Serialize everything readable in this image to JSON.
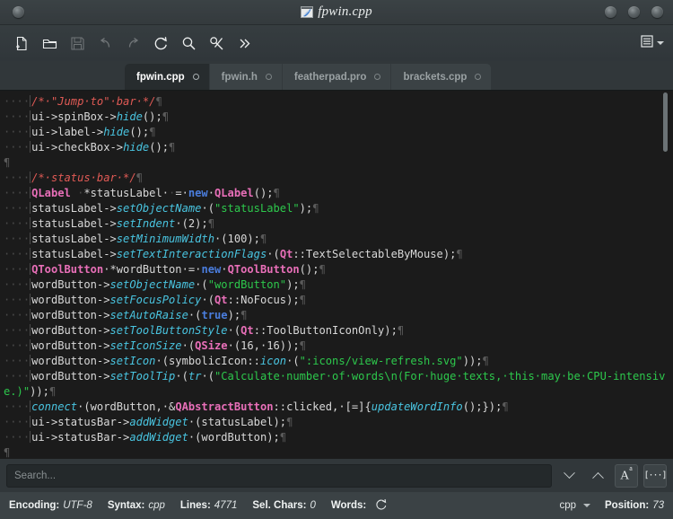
{
  "window": {
    "title": "fpwin.cpp",
    "icon": "featherpad-icon",
    "left_buttons": [
      "menu-button"
    ],
    "right_buttons": [
      "minimize-button",
      "maximize-button",
      "close-button"
    ]
  },
  "toolbar": {
    "items": [
      {
        "name": "new-file-button",
        "icon": "new-file-icon",
        "enabled": true
      },
      {
        "name": "open-file-button",
        "icon": "open-folder-icon",
        "enabled": true
      },
      {
        "name": "save-button",
        "icon": "save-disk-icon",
        "enabled": false
      },
      {
        "name": "undo-button",
        "icon": "undo-arrow-icon",
        "enabled": false
      },
      {
        "name": "redo-button",
        "icon": "redo-arrow-icon",
        "enabled": false
      },
      {
        "name": "reload-button",
        "icon": "reload-icon",
        "enabled": true
      },
      {
        "name": "find-button",
        "icon": "search-icon",
        "enabled": true
      },
      {
        "name": "replace-button",
        "icon": "cut-scissors-icon",
        "enabled": true
      },
      {
        "name": "overflow-button",
        "icon": "double-chevron-right-icon",
        "enabled": true
      }
    ],
    "menu_icon": "hamburger-menu-icon",
    "menu_caret": "chevron-down-icon"
  },
  "tabs": [
    {
      "label": "fpwin.cpp",
      "active": true
    },
    {
      "label": "fpwin.h",
      "active": false
    },
    {
      "label": "featherpad.pro",
      "active": false
    },
    {
      "label": "brackets.cpp",
      "active": false
    }
  ],
  "editor": {
    "lines": [
      [
        {
          "t": "    ",
          "c": "ws-dots"
        },
        {
          "t": "|",
          "c": "guide"
        },
        {
          "t": "/* \"Jump to\" bar */",
          "c": "cmt"
        },
        {
          "t": "¶",
          "c": "pilcrow"
        }
      ],
      [
        {
          "t": "    ",
          "c": "ws-dots"
        },
        {
          "t": "|",
          "c": "guide"
        },
        {
          "t": "ui->spinBox->",
          "c": "plain"
        },
        {
          "t": "hide",
          "c": "fn"
        },
        {
          "t": "();",
          "c": "plain"
        },
        {
          "t": "¶",
          "c": "pilcrow"
        }
      ],
      [
        {
          "t": "    ",
          "c": "ws-dots"
        },
        {
          "t": "|",
          "c": "guide"
        },
        {
          "t": "ui->label->",
          "c": "plain"
        },
        {
          "t": "hide",
          "c": "fn"
        },
        {
          "t": "();",
          "c": "plain"
        },
        {
          "t": "¶",
          "c": "pilcrow"
        }
      ],
      [
        {
          "t": "    ",
          "c": "ws-dots"
        },
        {
          "t": "|",
          "c": "guide"
        },
        {
          "t": "ui->checkBox->",
          "c": "plain"
        },
        {
          "t": "hide",
          "c": "fn"
        },
        {
          "t": "();",
          "c": "plain"
        },
        {
          "t": "¶",
          "c": "pilcrow"
        }
      ],
      [
        {
          "t": "¶",
          "c": "pilcrow"
        }
      ],
      [
        {
          "t": "    ",
          "c": "ws-dots"
        },
        {
          "t": "|",
          "c": "guide"
        },
        {
          "t": "/* status bar */",
          "c": "cmt"
        },
        {
          "t": "¶",
          "c": "pilcrow"
        }
      ],
      [
        {
          "t": "    ",
          "c": "ws-dots"
        },
        {
          "t": "|",
          "c": "guide"
        },
        {
          "t": "QLabel",
          "c": "type"
        },
        {
          "t": " ·",
          "c": "dot"
        },
        {
          "t": "*statusLabel ",
          "c": "plain"
        },
        {
          "t": "·",
          "c": "dot"
        },
        {
          "t": "= ",
          "c": "plain"
        },
        {
          "t": "new",
          "c": "kw"
        },
        {
          "t": " ",
          "c": "plain"
        },
        {
          "t": "QLabel",
          "c": "type"
        },
        {
          "t": "();",
          "c": "plain"
        },
        {
          "t": "¶",
          "c": "pilcrow"
        }
      ],
      [
        {
          "t": "    ",
          "c": "ws-dots"
        },
        {
          "t": "|",
          "c": "guide"
        },
        {
          "t": "statusLabel->",
          "c": "plain"
        },
        {
          "t": "setObjectName",
          "c": "fn"
        },
        {
          "t": " (",
          "c": "plain"
        },
        {
          "t": "\"statusLabel\"",
          "c": "str"
        },
        {
          "t": ");",
          "c": "plain"
        },
        {
          "t": "¶",
          "c": "pilcrow"
        }
      ],
      [
        {
          "t": "    ",
          "c": "ws-dots"
        },
        {
          "t": "|",
          "c": "guide"
        },
        {
          "t": "statusLabel->",
          "c": "plain"
        },
        {
          "t": "setIndent",
          "c": "fn"
        },
        {
          "t": " (2);",
          "c": "plain"
        },
        {
          "t": "¶",
          "c": "pilcrow"
        }
      ],
      [
        {
          "t": "    ",
          "c": "ws-dots"
        },
        {
          "t": "|",
          "c": "guide"
        },
        {
          "t": "statusLabel->",
          "c": "plain"
        },
        {
          "t": "setMinimumWidth",
          "c": "fn"
        },
        {
          "t": " (100);",
          "c": "plain"
        },
        {
          "t": "¶",
          "c": "pilcrow"
        }
      ],
      [
        {
          "t": "    ",
          "c": "ws-dots"
        },
        {
          "t": "|",
          "c": "guide"
        },
        {
          "t": "statusLabel->",
          "c": "plain"
        },
        {
          "t": "setTextInteractionFlags",
          "c": "fn"
        },
        {
          "t": " (",
          "c": "plain"
        },
        {
          "t": "Qt",
          "c": "type"
        },
        {
          "t": "::TextSelectableByMouse);",
          "c": "plain"
        },
        {
          "t": "¶",
          "c": "pilcrow"
        }
      ],
      [
        {
          "t": "    ",
          "c": "ws-dots"
        },
        {
          "t": "|",
          "c": "guide"
        },
        {
          "t": "QToolButton",
          "c": "type"
        },
        {
          "t": " *wordButton ",
          "c": "plain"
        },
        {
          "t": "= ",
          "c": "plain"
        },
        {
          "t": "new",
          "c": "kw"
        },
        {
          "t": " ",
          "c": "plain"
        },
        {
          "t": "QToolButton",
          "c": "type"
        },
        {
          "t": "();",
          "c": "plain"
        },
        {
          "t": "¶",
          "c": "pilcrow"
        }
      ],
      [
        {
          "t": "    ",
          "c": "ws-dots"
        },
        {
          "t": "|",
          "c": "guide"
        },
        {
          "t": "wordButton->",
          "c": "plain"
        },
        {
          "t": "setObjectName",
          "c": "fn"
        },
        {
          "t": " (",
          "c": "plain"
        },
        {
          "t": "\"wordButton\"",
          "c": "str"
        },
        {
          "t": ");",
          "c": "plain"
        },
        {
          "t": "¶",
          "c": "pilcrow"
        }
      ],
      [
        {
          "t": "    ",
          "c": "ws-dots"
        },
        {
          "t": "|",
          "c": "guide"
        },
        {
          "t": "wordButton->",
          "c": "plain"
        },
        {
          "t": "setFocusPolicy",
          "c": "fn"
        },
        {
          "t": " (",
          "c": "plain"
        },
        {
          "t": "Qt",
          "c": "type"
        },
        {
          "t": "::NoFocus);",
          "c": "plain"
        },
        {
          "t": "¶",
          "c": "pilcrow"
        }
      ],
      [
        {
          "t": "    ",
          "c": "ws-dots"
        },
        {
          "t": "|",
          "c": "guide"
        },
        {
          "t": "wordButton->",
          "c": "plain"
        },
        {
          "t": "setAutoRaise",
          "c": "fn"
        },
        {
          "t": " (",
          "c": "plain"
        },
        {
          "t": "true",
          "c": "kw"
        },
        {
          "t": ");",
          "c": "plain"
        },
        {
          "t": "¶",
          "c": "pilcrow"
        }
      ],
      [
        {
          "t": "    ",
          "c": "ws-dots"
        },
        {
          "t": "|",
          "c": "guide"
        },
        {
          "t": "wordButton->",
          "c": "plain"
        },
        {
          "t": "setToolButtonStyle",
          "c": "fn"
        },
        {
          "t": " (",
          "c": "plain"
        },
        {
          "t": "Qt",
          "c": "type"
        },
        {
          "t": "::ToolButtonIconOnly);",
          "c": "plain"
        },
        {
          "t": "¶",
          "c": "pilcrow"
        }
      ],
      [
        {
          "t": "    ",
          "c": "ws-dots"
        },
        {
          "t": "|",
          "c": "guide"
        },
        {
          "t": "wordButton->",
          "c": "plain"
        },
        {
          "t": "setIconSize",
          "c": "fn"
        },
        {
          "t": " (",
          "c": "plain"
        },
        {
          "t": "QSize",
          "c": "type"
        },
        {
          "t": " (16, 16));",
          "c": "plain"
        },
        {
          "t": "¶",
          "c": "pilcrow"
        }
      ],
      [
        {
          "t": "    ",
          "c": "ws-dots"
        },
        {
          "t": "|",
          "c": "guide"
        },
        {
          "t": "wordButton->",
          "c": "plain"
        },
        {
          "t": "setIcon",
          "c": "fn"
        },
        {
          "t": " (symbolicIcon::",
          "c": "plain"
        },
        {
          "t": "icon",
          "c": "fn"
        },
        {
          "t": " (",
          "c": "plain"
        },
        {
          "t": "\":icons/view-refresh.svg\"",
          "c": "str"
        },
        {
          "t": "));",
          "c": "plain"
        },
        {
          "t": "¶",
          "c": "pilcrow"
        }
      ],
      [
        {
          "t": "    ",
          "c": "ws-dots"
        },
        {
          "t": "|",
          "c": "guide"
        },
        {
          "t": "wordButton->",
          "c": "plain"
        },
        {
          "t": "setToolTip",
          "c": "fn"
        },
        {
          "t": " (",
          "c": "plain"
        },
        {
          "t": "tr",
          "c": "fn"
        },
        {
          "t": " (",
          "c": "plain"
        },
        {
          "t": "\"Calculate number of words\\n(For huge texts, this may be CPU-intensive.)\"",
          "c": "str"
        },
        {
          "t": "));",
          "c": "plain"
        },
        {
          "t": "¶",
          "c": "pilcrow"
        }
      ],
      [
        {
          "t": "    ",
          "c": "ws-dots"
        },
        {
          "t": "|",
          "c": "guide"
        },
        {
          "t": "connect",
          "c": "fn"
        },
        {
          "t": " (wordButton, &",
          "c": "plain"
        },
        {
          "t": "QAbstractButton",
          "c": "type"
        },
        {
          "t": "::clicked, [=]{",
          "c": "plain"
        },
        {
          "t": "updateWordInfo",
          "c": "fn"
        },
        {
          "t": "();});",
          "c": "plain"
        },
        {
          "t": "¶",
          "c": "pilcrow"
        }
      ],
      [
        {
          "t": "    ",
          "c": "ws-dots"
        },
        {
          "t": "|",
          "c": "guide"
        },
        {
          "t": "ui->statusBar->",
          "c": "plain"
        },
        {
          "t": "addWidget",
          "c": "fn"
        },
        {
          "t": " (statusLabel);",
          "c": "plain"
        },
        {
          "t": "¶",
          "c": "pilcrow"
        }
      ],
      [
        {
          "t": "    ",
          "c": "ws-dots"
        },
        {
          "t": "|",
          "c": "guide"
        },
        {
          "t": "ui->statusBar->",
          "c": "plain"
        },
        {
          "t": "addWidget",
          "c": "fn"
        },
        {
          "t": " (wordButton);",
          "c": "plain"
        },
        {
          "t": "¶",
          "c": "pilcrow"
        }
      ],
      [
        {
          "t": "¶",
          "c": "pilcrow"
        }
      ]
    ],
    "colors": {
      "background": "#1b1b1b",
      "text": "#d8d8d8",
      "comment": "#e05a55",
      "function": "#49c4e0",
      "type": "#e86fb8",
      "keyword": "#4a7ddd",
      "string": "#2dc84c",
      "whitespace": "#4a4a4a"
    }
  },
  "search": {
    "placeholder": "Search...",
    "value": "",
    "next_icon": "chevron-down-icon",
    "prev_icon": "chevron-up-icon",
    "case_sensitive_label": "A",
    "case_sensitive_sup": "a",
    "whole_word_label": "[···]"
  },
  "statusbar": {
    "encoding_label": "Encoding:",
    "encoding_value": "UTF-8",
    "syntax_label": "Syntax:",
    "syntax_value": "cpp",
    "lines_label": "Lines:",
    "lines_value": "4771",
    "sel_chars_label": "Sel. Chars:",
    "sel_chars_value": "0",
    "words_label": "Words:",
    "words_refresh_icon": "refresh-icon",
    "syntax_combo_value": "cpp",
    "syntax_combo_caret": "chevron-down-icon",
    "position_label": "Position:",
    "position_value": "73"
  }
}
